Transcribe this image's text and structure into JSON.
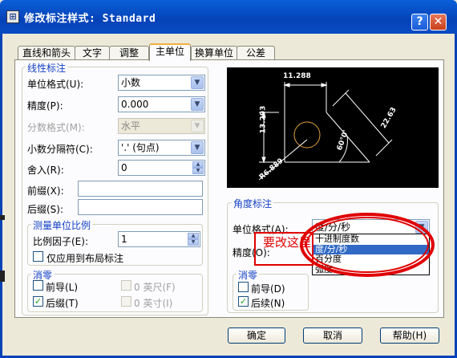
{
  "window": {
    "title": "修改标注样式: Standard",
    "icon": "dim-style-icon",
    "help_glyph": "?",
    "close_glyph": "✕"
  },
  "tabs": [
    {
      "label": "直线和箭头"
    },
    {
      "label": "文字"
    },
    {
      "label": "调整"
    },
    {
      "label": "主单位",
      "active": true
    },
    {
      "label": "换算单位"
    },
    {
      "label": "公差"
    }
  ],
  "linear": {
    "group_label": "线性标注",
    "unit_format": {
      "label": "单位格式(U):",
      "value": "小数"
    },
    "precision": {
      "label": "精度(P):",
      "value": "0.000"
    },
    "fraction_format": {
      "label": "分数格式(M):",
      "value": "水平"
    },
    "decimal_separator": {
      "label": "小数分隔符(C):",
      "value": "'.' (句点)"
    },
    "round_off": {
      "label": "舍入(R):",
      "value": "0"
    },
    "prefix": {
      "label": "前缀(X):",
      "value": ""
    },
    "suffix": {
      "label": "后缀(S):",
      "value": ""
    }
  },
  "scale": {
    "group_label": "测量单位比例",
    "factor": {
      "label": "比例因子(E):",
      "value": "1"
    },
    "layout_only": {
      "label": "仅应用到布局标注",
      "checked": false
    }
  },
  "zero_left": {
    "group_label": "消零",
    "leading": {
      "label": "前导(L)",
      "checked": false
    },
    "trailing": {
      "label": "后缀(T)",
      "checked": true
    },
    "feet": {
      "label": "0 英尺(F)",
      "checked": false
    },
    "inches": {
      "label": "0 英寸(I)",
      "checked": false
    }
  },
  "preview": {
    "dim_top": "11.288",
    "dim_left": "13.293",
    "dim_right": "22.63",
    "dim_angle": "60°0'",
    "dim_radius": "R6.889"
  },
  "angular": {
    "group_label": "角度标注",
    "unit_format": {
      "label": "单位格式(A):",
      "value": "度/分/秒"
    },
    "precision": {
      "label": "精度(O):"
    },
    "dropdown_options": [
      {
        "label": "十进制度数",
        "selected": false
      },
      {
        "label": "度/分/秒",
        "selected": true
      },
      {
        "label": "百分度",
        "selected": false
      },
      {
        "label": "弧度",
        "selected": false
      }
    ],
    "zero": {
      "group_label": "消零",
      "leading": {
        "label": "前导(D)",
        "checked": false
      },
      "trailing": {
        "label": "后续(N)",
        "checked": true
      }
    }
  },
  "annotation": {
    "text": "要改这里",
    "color": "#e00000"
  },
  "buttons": {
    "ok": "确定",
    "cancel": "取消",
    "help": "帮助(H)"
  },
  "colors": {
    "title_bar": "#0a5fd8",
    "accent_blue": "#1540c4",
    "selection": "#316ac5",
    "preview_lines": "#ffffff",
    "preview_circle": "#e0a040"
  }
}
